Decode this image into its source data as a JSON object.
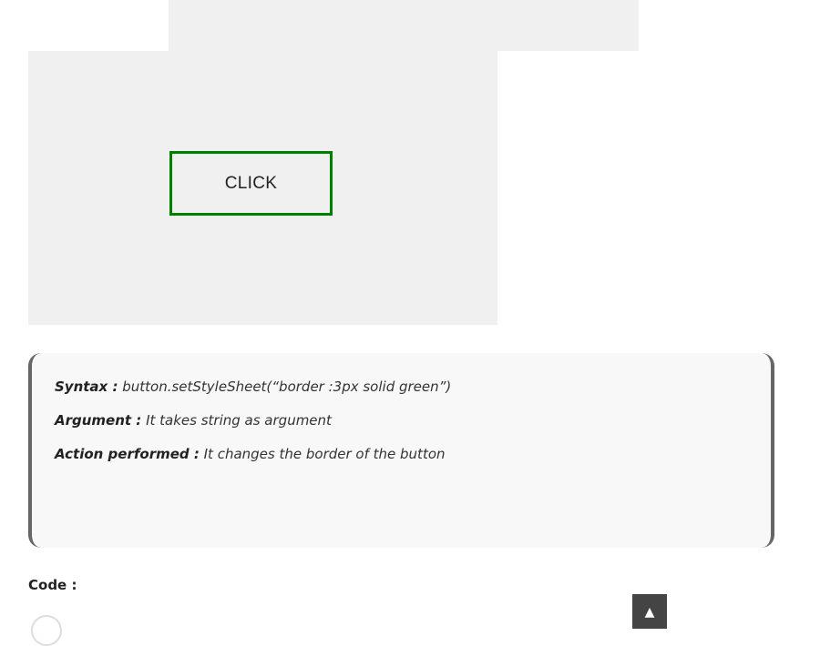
{
  "demo": {
    "button_label": "CLICK",
    "border_color": "#008000"
  },
  "info": {
    "syntax_key": "Syntax :",
    "syntax_value": " button.setStyleSheet(“border :3px solid green”)",
    "argument_key": "Argument :",
    "argument_value": " It takes string as argument",
    "action_key": "Action performed :",
    "action_value": " It changes the border of the button"
  },
  "code": {
    "heading": "Code :"
  },
  "scroll_top": {
    "icon": "arrow-up-icon",
    "glyph": "▲"
  }
}
